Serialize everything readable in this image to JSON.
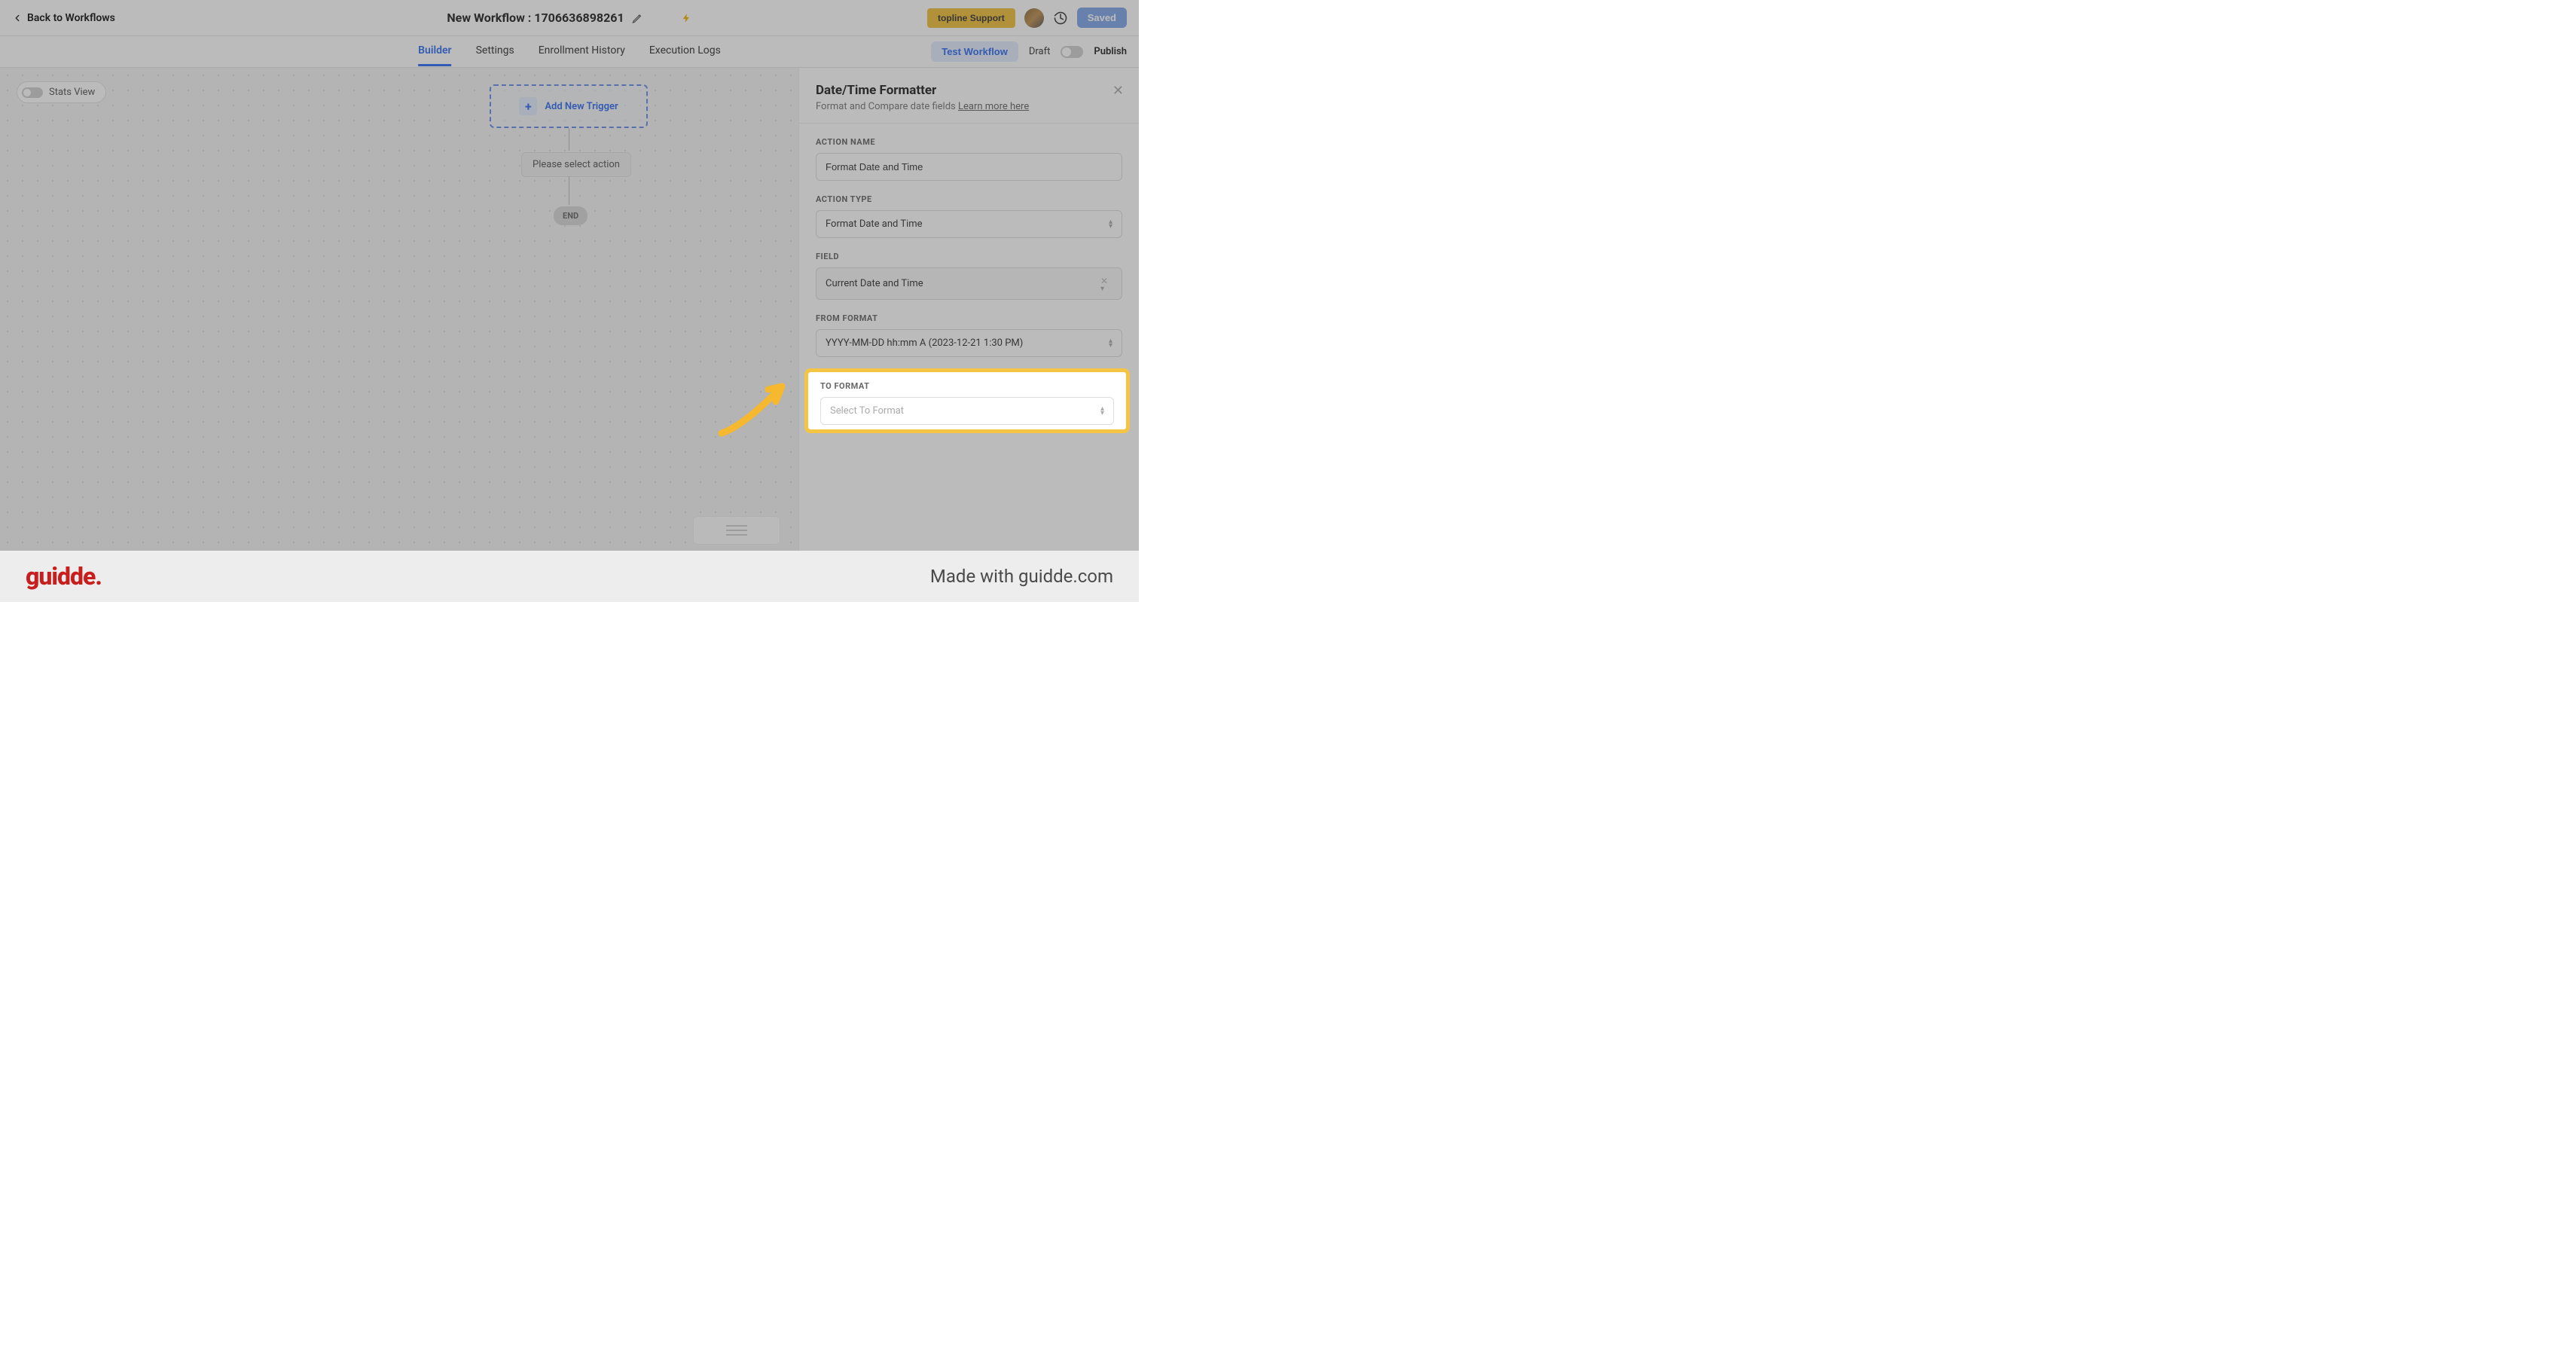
{
  "topbar": {
    "back": "Back to Workflows",
    "title": "New Workflow : 1706636898261",
    "support": "topline Support",
    "saved": "Saved"
  },
  "tabs": {
    "builder": "Builder",
    "settings": "Settings",
    "enrollment": "Enrollment History",
    "execution": "Execution Logs",
    "test": "Test Workflow",
    "draft": "Draft",
    "publish": "Publish"
  },
  "canvas": {
    "stats": "Stats View",
    "trigger": "Add New Trigger",
    "select_action": "Please select action",
    "end": "END"
  },
  "panel": {
    "title": "Date/Time Formatter",
    "subtitle": "Format and Compare date fields ",
    "learn": "Learn more here",
    "labels": {
      "action_name": "ACTION NAME",
      "action_type": "ACTION TYPE",
      "field": "FIELD",
      "from_format": "FROM FORMAT",
      "to_format": "TO FORMAT"
    },
    "values": {
      "action_name": "Format Date and Time",
      "action_type": "Format Date and Time",
      "field": "Current Date and Time",
      "from_format": "YYYY-MM-DD hh:mm A (2023-12-21 1:30 PM)",
      "to_format": "Select To Format"
    }
  },
  "footer": {
    "logo": "guidde.",
    "made": "Made with guidde.com"
  }
}
